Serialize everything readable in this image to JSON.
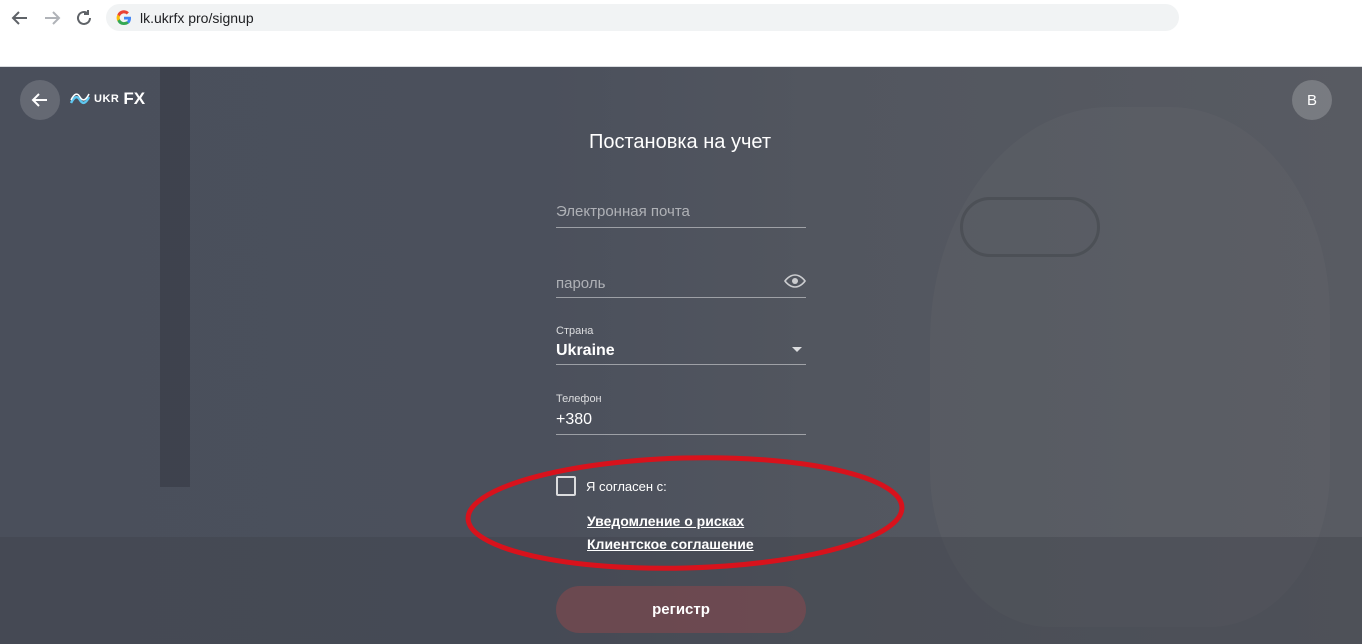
{
  "browser": {
    "url": "lk.ukrfx pro/signup"
  },
  "header": {
    "logo_prefix": "UKR",
    "logo_suffix": "FX",
    "language_button": "B"
  },
  "form": {
    "title": "Постановка на учет",
    "email_placeholder": "Электронная почта",
    "password_placeholder": "пароль",
    "country_label": "Страна",
    "country_value": "Ukraine",
    "phone_label": "Телефон",
    "phone_value": "+380",
    "agree_text": "Я согласен с:",
    "link_risk": "Уведомление о рисках",
    "link_agreement": "Клиентское соглашение",
    "register_label": "регистр"
  },
  "colors": {
    "annotation_ellipse": "#d8121c",
    "register_button": "#80484e"
  },
  "icons": [
    "back-arrow-icon",
    "forward-arrow-icon",
    "reload-icon",
    "google-icon",
    "eye-icon",
    "chevron-down-icon"
  ]
}
